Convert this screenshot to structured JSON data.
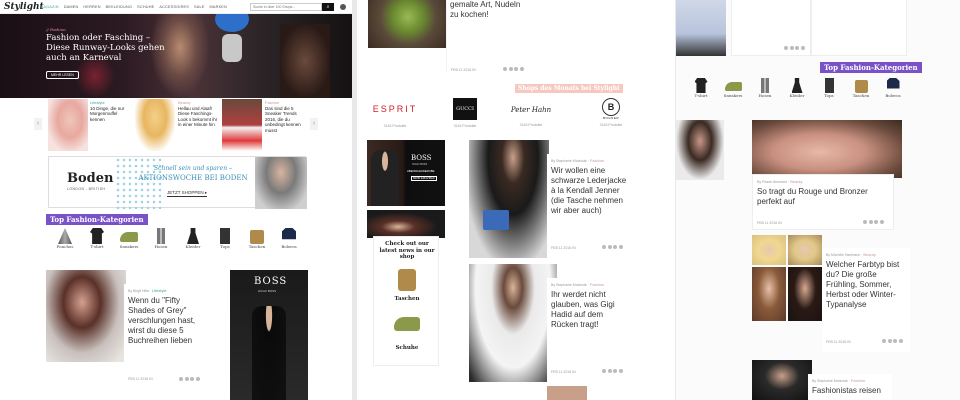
{
  "header": {
    "logo": "Stylight",
    "nav": [
      "MAGAZIN",
      "DAMEN",
      "HERREN",
      "BEKLEIDUNG",
      "SCHUHE",
      "ACCESSOIRES",
      "SALE",
      "MARKEN"
    ],
    "search_placeholder": "Suche in über 100 Shops..."
  },
  "hero": {
    "category": "// Fashion",
    "title": "Fashion oder Fasching – Diese Runway-Looks gehen auch an Karneval",
    "cta": "MEHR LESEN"
  },
  "carousel": [
    {
      "cat": "Lifestyle",
      "text": "10 Dinge, die nur Morgenmuffel kennen"
    },
    {
      "cat": "Beauty",
      "text": "Hellau und Alaaf! Diese Faschings-Look s bekommt ihr in einer Minute hin"
    },
    {
      "cat": "Fashion",
      "text": "Das sind die 5 Sneaker Trends 2016, die du unbedingt kennen musst"
    }
  ],
  "ad": {
    "brand": "Boden",
    "brand_sub": "LONDON - BRITISH",
    "line1": "Schnell sein und sparen –",
    "line2": "AKTIONSWOCHE BEI BODEN",
    "cta": "JETZT SHOPPEN ▸"
  },
  "top_categories": {
    "label": "Top Fashion-Kategorien",
    "items": [
      "Ponchos",
      "T-shirt",
      "Sneakers",
      "Hosen",
      "Kleider",
      "Tops",
      "Taschen",
      "Boleros"
    ]
  },
  "top_categories_right": {
    "label": "Top Fashion-Kategorien",
    "items": [
      "T-shirt",
      "Sneakers",
      "Hosen",
      "Kleider",
      "Tops",
      "Taschen",
      "Boleros"
    ]
  },
  "panel1_article": {
    "author": "By Birgit Hilla",
    "cat": "Lifestyle",
    "title": "Wenn du \"Fifty Shades of Grey\" verschlungen hast, wirst du diese 5 Buchreihen lieben",
    "date": "FEB 11 2016 IN"
  },
  "boss_ad": {
    "logo": "BOSS",
    "sub": "HUGO BOSS"
  },
  "panel2_top": {
    "text": "gemalte Art, Nudeln zu kochen!",
    "date": "FEB 11 2016 IN"
  },
  "shops": {
    "label": "Shops des Monats bei Stylight",
    "items": [
      {
        "name": "ESPRIT",
        "count": "3146 Produkte"
      },
      {
        "name": "GUCCI",
        "count": "3146 Produkte"
      },
      {
        "name": "Peter Hahn",
        "count": "3146 Produkte"
      },
      {
        "name": "BOGNER",
        "count": "3146 Produkte"
      }
    ]
  },
  "boss_small": {
    "logo": "BOSS",
    "sub": "HUGO BOSS",
    "line": "ABENDGARDEROBE",
    "cta": "MEHR ERFAHREN"
  },
  "shop_box": {
    "title": "Check out our latest news in our shop",
    "items": [
      "Taschen",
      "Schuhe"
    ]
  },
  "panel2_articles": [
    {
      "author": "By Stephanie Motzniak",
      "cat": "Fashion",
      "title": "Wir wollen eine schwarze Lederjacke à la Kendall Jenner (die Tasche nehmen wir aber auch)",
      "date": "FEB 11 2016 IN"
    },
    {
      "author": "By Stephanie Motzniak",
      "cat": "Fashion",
      "title": "Ihr werdet nicht glauben, was Gigi Hadid auf dem Rücken tragt!",
      "date": "FEB 11 2016 IN"
    }
  ],
  "panel3_articles": [
    {
      "author": "By Friane Ahrmann",
      "cat": "Beauty",
      "title": "So tragt du Rouge und Bronzer perfekt auf",
      "date": "FEB 11 2016 IN"
    },
    {
      "author": "By Michelle Hartmann",
      "cat": "Beauty",
      "title": "Welcher Farbtyp bist du? Die große Frühling, Sommer, Herbst oder Winter-Typanalyse",
      "date": "FEB 11 2016 IN"
    },
    {
      "author": "By Stephanie Motzniak",
      "cat": "Fashion",
      "title": "Fashionistas reisen"
    }
  ],
  "colors": {
    "purple": "#7a52c7",
    "pink": "#f7c8c0",
    "accent_teal": "#3aa6a0"
  }
}
